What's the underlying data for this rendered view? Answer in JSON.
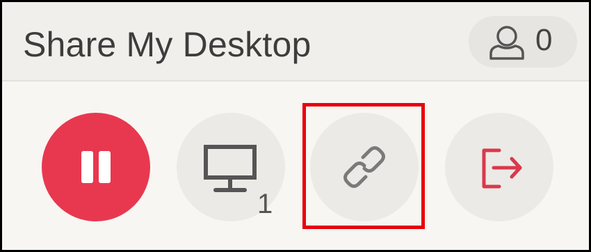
{
  "header": {
    "title": "Share My Desktop",
    "viewers": {
      "icon": "person-icon",
      "count": "0"
    }
  },
  "controls": [
    {
      "id": "pause",
      "icon": "pause-icon",
      "color": "#e8384f"
    },
    {
      "id": "screens",
      "icon": "monitor-icon",
      "count": "1"
    },
    {
      "id": "link",
      "icon": "link-icon"
    },
    {
      "id": "exit",
      "icon": "exit-icon",
      "color": "#d9394c"
    }
  ],
  "highlight": {
    "target": "link",
    "color": "#e8000b"
  }
}
